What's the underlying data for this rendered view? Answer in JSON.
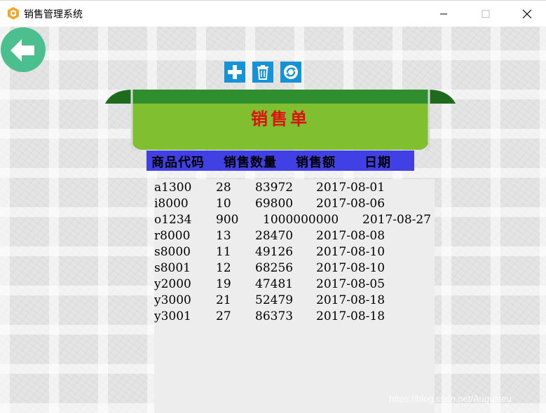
{
  "window": {
    "title": "销售管理系统"
  },
  "banner": {
    "title": "销售单"
  },
  "table": {
    "headers": [
      "商品代码",
      "销售数量",
      "销售额",
      "日期"
    ],
    "rows": [
      [
        "a1300",
        "28",
        "83972",
        "2017-08-01"
      ],
      [
        "i8000",
        "10",
        "69800",
        "2017-08-06"
      ],
      [
        "o1234",
        "900",
        "1000000000",
        "2017-08-27"
      ],
      [
        "r8000",
        "13",
        "28470",
        "2017-08-08"
      ],
      [
        "s8000",
        "11",
        "49126",
        "2017-08-10"
      ],
      [
        "s8001",
        "12",
        "68256",
        "2017-08-10"
      ],
      [
        "y2000",
        "19",
        "47481",
        "2017-08-05"
      ],
      [
        "y3000",
        "21",
        "52479",
        "2017-08-18"
      ],
      [
        "y3001",
        "27",
        "86373",
        "2017-08-18"
      ]
    ]
  },
  "watermark": "https://blog.csdn.net/Augusteu",
  "colors": {
    "accent_blue": "#1692d6",
    "header_bar": "#4040e4",
    "banner_green": "#7fbf30",
    "banner_title": "#e01010",
    "back_button": "#4cbf8f"
  }
}
